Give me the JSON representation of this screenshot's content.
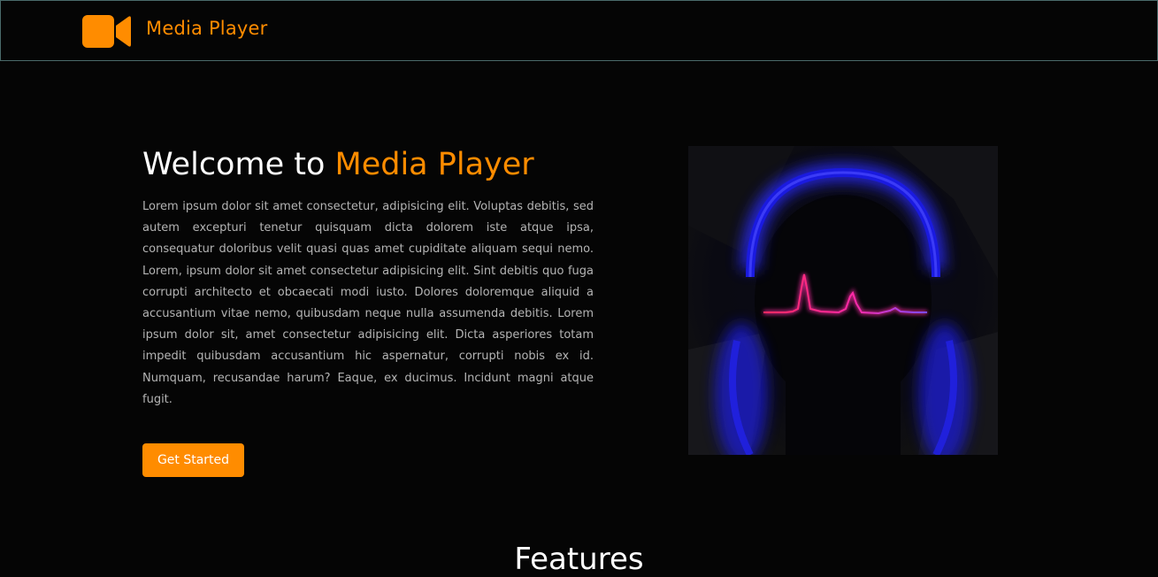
{
  "nav": {
    "logo_icon": "video-camera-icon",
    "title": "Media Player"
  },
  "hero": {
    "heading_prefix": "Welcome to ",
    "heading_accent": "Media Player",
    "paragraph": "Lorem ipsum dolor sit amet consectetur, adipisicing elit. Voluptas debitis, sed autem excepturi tenetur quisquam dicta dolorem iste atque ipsa, consequatur doloribus velit quasi quas amet cupiditate aliquam sequi nemo. Lorem, ipsum dolor sit amet consectetur adipisicing elit. Sint debitis quo fuga corrupti architecto et obcaecati modi iusto. Dolores doloremque aliquid a accusantium vitae nemo, quibusdam neque nulla assumenda debitis. Lorem ipsum dolor sit, amet consectetur adipisicing elit. Dicta asperiores totam impedit quibusdam accusantium hic aspernatur, corrupti nobis ex id. Numquam, recusandae harum? Eaque, ex ducimus. Incidunt magni atque fugit.",
    "button_label": "Get Started"
  },
  "features": {
    "title": "Features"
  },
  "colors": {
    "background": "#050505",
    "accent": "#ff8c00",
    "text": "#ffffff",
    "muted_text": "#b4b4b4"
  }
}
